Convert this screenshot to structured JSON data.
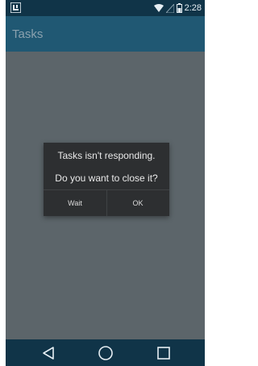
{
  "status_bar": {
    "time": "2:28",
    "icons": [
      "app-badge-icon",
      "wifi-icon",
      "signal-icon",
      "battery-icon"
    ]
  },
  "action_bar": {
    "title": "Tasks"
  },
  "dialog": {
    "message_line1": "Tasks isn't responding.",
    "message_line2": "Do you want to close it?",
    "wait_label": "Wait",
    "ok_label": "OK"
  },
  "nav_bar": {
    "icons": [
      "back-icon",
      "home-icon",
      "recent-apps-icon"
    ]
  },
  "colors": {
    "status_bar": "#103448",
    "action_bar": "#205873",
    "dim_overlay": "#5c656a",
    "dialog_bg": "#2d2f31"
  }
}
